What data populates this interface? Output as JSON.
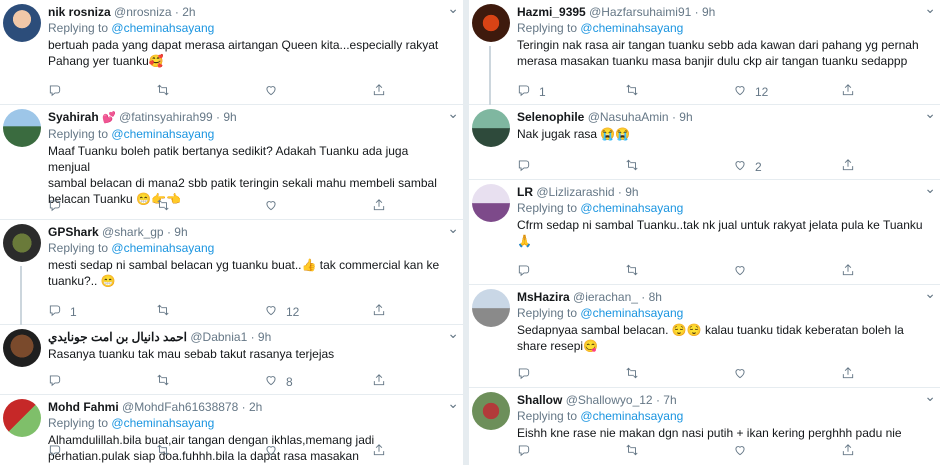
{
  "left": [
    {
      "name": "nik rosniza",
      "badge": "",
      "handle": "@nrosniza",
      "time": "· 2h",
      "reply_prefix": "Replying to",
      "mention": "@cheminahsayang",
      "lines": [
        "bertuah pada yang dapat merasa airtangan Queen kita...especially rakyat",
        "Pahang yer tuanku🥰"
      ],
      "replies": "",
      "retweets": "",
      "likes": ""
    },
    {
      "name": "Syahirah",
      "badge": "💕",
      "handle": "@fatinsyahirah99",
      "time": "· 9h",
      "reply_prefix": "Replying to",
      "mention": "@cheminahsayang",
      "lines": [
        "Maaf Tuanku boleh patik bertanya sedikit? Adakah Tuanku ada juga menjual",
        "sambal belacan di mana2 sbb patik teringin sekali mahu membeli sambal",
        "belacan Tuanku 😁👉👈"
      ],
      "replies": "",
      "retweets": "",
      "likes": ""
    },
    {
      "name": "GPShark",
      "badge": "",
      "handle": "@shark_gp",
      "time": "· 9h",
      "reply_prefix": "Replying to",
      "mention": "@cheminahsayang",
      "lines": [
        "mesti sedap ni sambal belacan yg tuanku buat..👍 tak commercial kan ke",
        "tuanku?.. 😁"
      ],
      "replies": "1",
      "retweets": "",
      "likes": "12"
    },
    {
      "name": "احمد دانيال بن امت جونايدي",
      "badge": "",
      "handle": "@Dabnia1",
      "time": "· 9h",
      "reply_prefix": "",
      "mention": "",
      "lines": [
        "Rasanya tuanku tak mau sebab takut rasanya terjejas"
      ],
      "replies": "",
      "retweets": "",
      "likes": "8"
    },
    {
      "name": "Mohd Fahmi",
      "badge": "",
      "handle": "@MohdFah61638878",
      "time": "· 2h",
      "reply_prefix": "Replying to",
      "mention": "@cheminahsayang",
      "lines": [
        "Alhamdulillah.bila buat,air tangan dengan ikhlas,memang jadi",
        "perhatian.pulak siap doa.fuhhh.bila la dapat rasa masakan"
      ],
      "replies": "",
      "retweets": "",
      "likes": ""
    }
  ],
  "right": [
    {
      "name": "Hazmi_9395",
      "badge": "",
      "handle": "@Hazfarsuhaimi91",
      "time": "· 9h",
      "reply_prefix": "Replying to",
      "mention": "@cheminahsayang",
      "lines": [
        "Teringin nak rasa air tangan tuanku sebb ada kawan dari pahang yg pernah",
        "merasa masakan tuanku masa banjir dulu ckp air tangan tuanku sedappp"
      ],
      "replies": "1",
      "retweets": "",
      "likes": "12"
    },
    {
      "name": "Selenophile",
      "badge": "",
      "handle": "@NasuhaAmin",
      "time": "· 9h",
      "reply_prefix": "",
      "mention": "",
      "lines": [
        "Nak jugak rasa 😭😭"
      ],
      "replies": "",
      "retweets": "",
      "likes": "2"
    },
    {
      "name": "LR",
      "badge": "",
      "handle": "@Lizlizarashid",
      "time": "· 9h",
      "reply_prefix": "Replying to",
      "mention": "@cheminahsayang",
      "lines": [
        "Cfrm sedap ni sambal Tuanku..tak nk jual untuk rakyat jelata pula ke Tuanku 🙏"
      ],
      "replies": "",
      "retweets": "",
      "likes": ""
    },
    {
      "name": "MsHazira",
      "badge": "",
      "handle": "@ierachan_",
      "time": "· 8h",
      "reply_prefix": "Replying to",
      "mention": "@cheminahsayang",
      "lines": [
        "Sedapnyaa sambal belacan. 😌😌 kalau tuanku tidak keberatan boleh la",
        "share resepi😋"
      ],
      "replies": "",
      "retweets": "",
      "likes": ""
    },
    {
      "name": "Shallow",
      "badge": "",
      "handle": "@Shallowyo_12",
      "time": "· 7h",
      "reply_prefix": "Replying to",
      "mention": "@cheminahsayang",
      "lines": [
        "Eishh kne rase nie makan dgn nasi putih + ikan kering perghhh padu nie"
      ],
      "replies": "",
      "retweets": "",
      "likes": ""
    }
  ],
  "icons": {
    "reply": "reply-icon",
    "retweet": "retweet-icon",
    "like": "heart-icon",
    "share": "share-icon",
    "caret": "chevron-down-icon"
  },
  "colors": {
    "mention": "#1b95e0",
    "muted": "#657786",
    "text": "#14171a",
    "divider": "#e6ecf0"
  }
}
